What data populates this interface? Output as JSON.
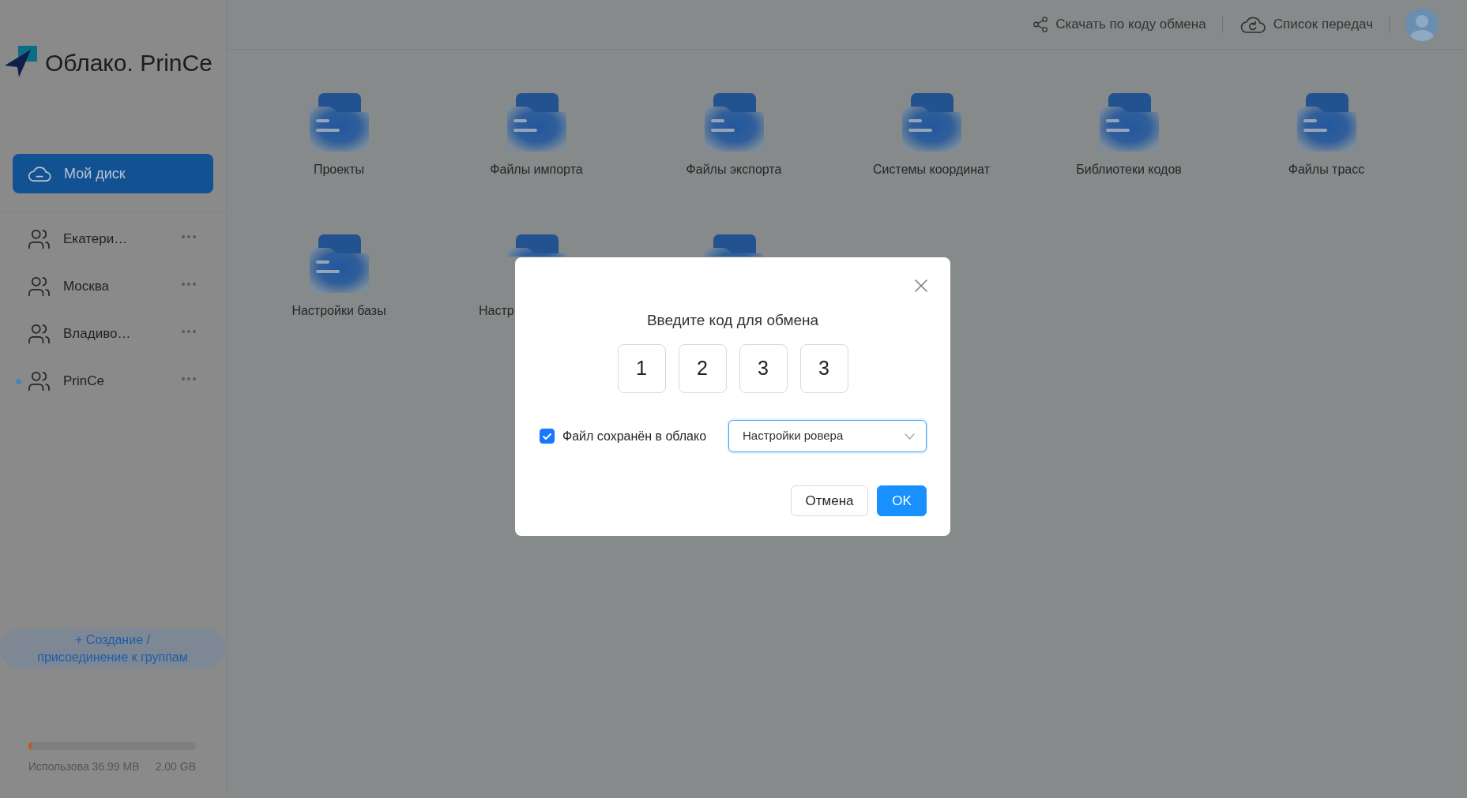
{
  "sidebar": {
    "logo": "Облако. PrinCe",
    "nav": [
      {
        "label": "Мой диск",
        "selected": true
      }
    ],
    "groups": [
      {
        "name": "Екатери…",
        "selected": false
      },
      {
        "name": "Москва",
        "selected": false
      },
      {
        "name": "Владиво…",
        "selected": false
      },
      {
        "name": "PrinCe",
        "selected": true
      }
    ],
    "create_button": "+ Создание / присоединение к группам",
    "storage": {
      "used": "Использова 36.99 MB",
      "total": "2.00 GB",
      "level": 0.02
    }
  },
  "header": {
    "actions": [
      {
        "kind": "share",
        "label": "Скачать по коду обмена"
      },
      {
        "kind": "transfers",
        "label": "Список передач"
      }
    ]
  },
  "folders": [
    {
      "name": "Проекты",
      "covered": false
    },
    {
      "name": "Файлы импорта",
      "covered": false
    },
    {
      "name": "Файлы экспорта",
      "covered": false
    },
    {
      "name": "Системы координат",
      "covered": false
    },
    {
      "name": "Библиотеки кодов",
      "covered": false
    },
    {
      "name": "Файлы трасс",
      "covered": false
    },
    {
      "name": "Настройки базы",
      "covered": false
    },
    {
      "name": "Настр",
      "covered": true
    },
    {
      "covered": true
    }
  ],
  "dialog": {
    "title": "Введите код для обмена",
    "code": [
      "1",
      "2",
      "3",
      "3"
    ],
    "checkbox": {
      "label": "Файл сохранён в облако",
      "checked": true
    },
    "select": {
      "value": "Настройки ровера",
      "focused": true
    },
    "buttons": [
      {
        "label": "Отмена",
        "kind": "secondary"
      },
      {
        "label": "OK",
        "kind": "primary"
      }
    ]
  }
}
